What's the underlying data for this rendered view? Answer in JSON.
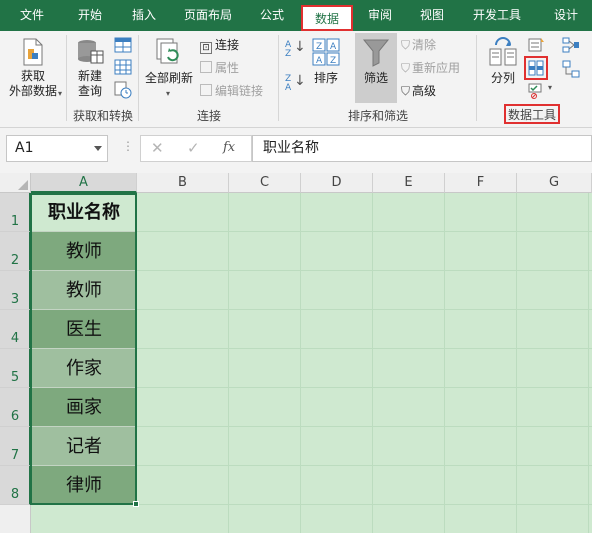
{
  "tabs": [
    {
      "label": "文件",
      "active": false
    },
    {
      "label": "开始",
      "active": false
    },
    {
      "label": "插入",
      "active": false
    },
    {
      "label": "页面布局",
      "active": false
    },
    {
      "label": "公式",
      "active": false
    },
    {
      "label": "数据",
      "active": true
    },
    {
      "label": "审阅",
      "active": false
    },
    {
      "label": "视图",
      "active": false
    },
    {
      "label": "开发工具",
      "active": false
    },
    {
      "label": "设计",
      "active": false
    }
  ],
  "ribbon": {
    "get_external": {
      "line1": "获取",
      "line2": "外部数据"
    },
    "new_query": {
      "line1": "新建",
      "line2": "查询"
    },
    "group_get_transform": "获取和转换",
    "refresh_all": "全部刷新",
    "connections": "连接",
    "properties": "属性",
    "edit_links": "编辑链接",
    "group_connections": "连接",
    "sort_az": "A Z",
    "sort_za": "Z A",
    "sort": "排序",
    "filter": "筛选",
    "clear": "清除",
    "reapply": "重新应用",
    "advanced": "高级",
    "group_sort_filter": "排序和筛选",
    "text_to_columns": "分列",
    "group_data_tools": "数据工具"
  },
  "formula_bar": {
    "name_box": "A1",
    "fx": "fx",
    "cancel_symbol": "✕",
    "enter_symbol": "✓",
    "content": "职业名称"
  },
  "sheet": {
    "columns": [
      "A",
      "B",
      "C",
      "D",
      "E",
      "F",
      "G"
    ],
    "rows": [
      "1",
      "2",
      "3",
      "4",
      "5",
      "6",
      "7",
      "8"
    ],
    "column_a": [
      "职业名称",
      "教师",
      "教师",
      "医生",
      "作家",
      "画家",
      "记者",
      "律师"
    ]
  },
  "colors": {
    "accent": "#217346",
    "highlight": "#e03030",
    "sheet_background": "#cfe9d0",
    "cell_dark": "#7ea97e",
    "cell_light": "#9fbf9f"
  }
}
